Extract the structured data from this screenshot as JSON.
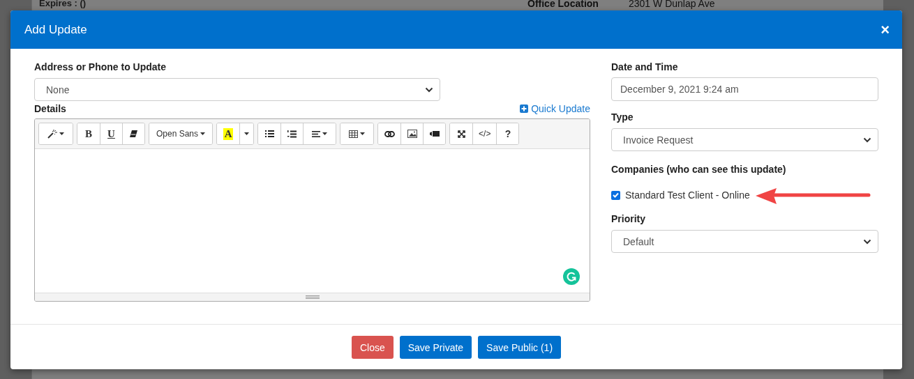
{
  "background_page": {
    "left_text": "Expires : ()",
    "right_label": "Office Location",
    "right_value": "2301 W Dunlap Ave"
  },
  "modal": {
    "title": "Add Update",
    "close": "×",
    "address": {
      "label": "Address or Phone to Update",
      "value": "None"
    },
    "details": {
      "label": "Details",
      "quick_link": "Quick Update",
      "toolbar": [
        [
          {
            "kind": "style"
          }
        ],
        [
          {
            "kind": "bold",
            "label": "B"
          },
          {
            "kind": "underline",
            "label": "U"
          },
          {
            "kind": "eraser"
          }
        ],
        [
          {
            "kind": "font",
            "label": "Open Sans"
          }
        ],
        [
          {
            "kind": "color",
            "label": "A"
          },
          {
            "kind": "caret"
          }
        ],
        [
          {
            "kind": "ul"
          },
          {
            "kind": "ol"
          },
          {
            "kind": "align"
          }
        ],
        [
          {
            "kind": "table"
          }
        ],
        [
          {
            "kind": "link"
          },
          {
            "kind": "image"
          },
          {
            "kind": "video"
          }
        ],
        [
          {
            "kind": "fullscreen"
          },
          {
            "kind": "code",
            "label": "</>"
          },
          {
            "kind": "help",
            "label": "?"
          }
        ]
      ]
    },
    "date": {
      "label": "Date and Time",
      "value": "December 9, 2021 9:24 am"
    },
    "type": {
      "label": "Type",
      "value": "Invoice Request"
    },
    "companies": {
      "label": "Companies (who can see this update)",
      "items": [
        {
          "label": "Standard Test Client - Online",
          "checked": true
        }
      ]
    },
    "priority": {
      "label": "Priority",
      "value": "Default"
    },
    "buttons": [
      {
        "label": "Close",
        "kind": "danger"
      },
      {
        "label": "Save Private",
        "kind": "primary"
      },
      {
        "label": "Save Public (1)",
        "kind": "primary"
      }
    ]
  }
}
